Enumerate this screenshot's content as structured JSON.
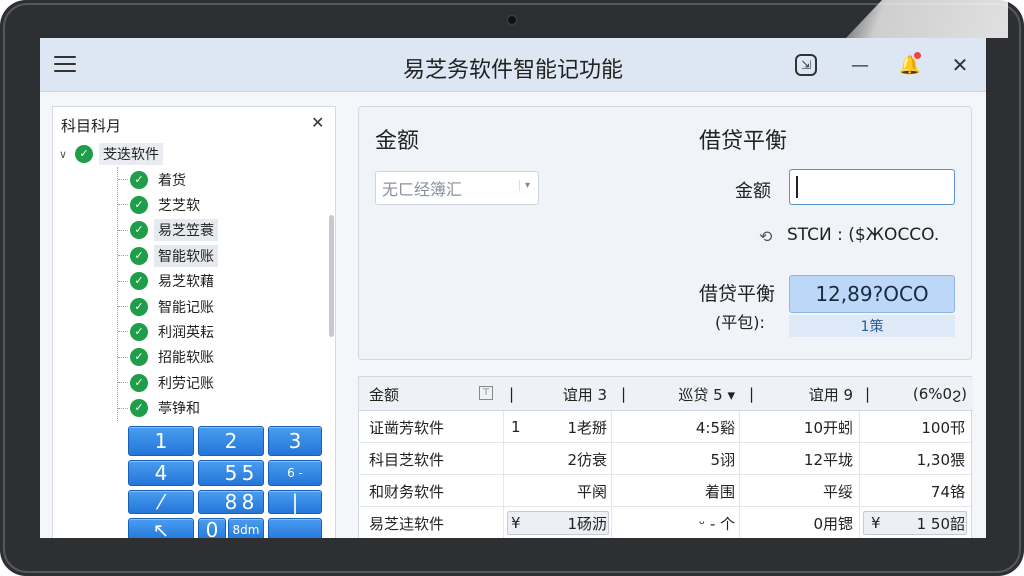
{
  "app": {
    "title": "易芝务软件智能记功能",
    "pin_glyph": "⇲",
    "minimize_glyph": "—",
    "bell_glyph": "🔔",
    "close_glyph": "✕"
  },
  "tree": {
    "header": "科目科月",
    "close_glyph": "✕",
    "root": {
      "label": "芠迭软件",
      "caret": "∨"
    },
    "items": [
      {
        "label": "着货",
        "selected": false
      },
      {
        "label": "芝芝软",
        "selected": false
      },
      {
        "label": "易芝笠蓑",
        "selected": true
      },
      {
        "label": "智能软账",
        "selected": true
      },
      {
        "label": "易芝软藉",
        "selected": false
      },
      {
        "label": "智能记账",
        "selected": false
      },
      {
        "label": "利润英耘",
        "selected": false
      },
      {
        "label": "招能软账",
        "selected": false
      },
      {
        "label": "利劳记账",
        "selected": false
      },
      {
        "label": "葶铮和",
        "selected": false
      }
    ],
    "check_glyph": "✓"
  },
  "keypad": {
    "keys": [
      "1",
      "2",
      "3",
      "4",
      "5",
      "5",
      "6 -",
      "⁄",
      "8",
      "8",
      "|",
      "↖",
      "0",
      "8dm",
      ""
    ]
  },
  "amount_panel": {
    "amount_title": "金额",
    "balance_title": "借贷平衡",
    "select_text": "无ㄈ经簿汇",
    "select_arrow": "▾",
    "amount_label": "金额",
    "amount_value": "",
    "link_glyph": "⟲",
    "stcn_text": "STCИ :   ($ЖOCCO.",
    "balance_label": "借贷平衡",
    "balance_sub": "(平包):",
    "balance_value": "12,89?OCO",
    "balance_unit": "1策"
  },
  "table": {
    "headers": [
      {
        "label": "金额"
      },
      {
        "label": "|"
      },
      {
        "label": "谊用 3"
      },
      {
        "label": "|"
      },
      {
        "label": "巡贷 5 ▾"
      },
      {
        "label": "|"
      },
      {
        "label": "谊用 9"
      },
      {
        "label": "|"
      },
      {
        "label": "(6%0ϩ)"
      }
    ],
    "filter_glyph": "⊤",
    "rows": [
      {
        "name": "证凿芳软件",
        "c1": "1",
        "c2": "1老掰",
        "c3": "4:5谿",
        "c4": "10开蚓",
        "c5": "100邗",
        "boxed": false
      },
      {
        "name": "科目芝软件",
        "c1": "",
        "c2": "2彷衰",
        "c3": "5诩",
        "c4": "12平垅",
        "c5": "1,30猥",
        "boxed": false
      },
      {
        "name": "和财务软件",
        "c1": "",
        "c2": "平阕",
        "c3": "着围",
        "c4": "平绥",
        "c5": "74铬",
        "boxed": false
      },
      {
        "name": "易芝迬软件",
        "c1": "¥",
        "c2": "1砀沥",
        "c3": "ᵕ - 个",
        "c4": "0用锶",
        "c5": "1 50韶",
        "c4_prefix": "¥",
        "boxed": true
      }
    ]
  }
}
